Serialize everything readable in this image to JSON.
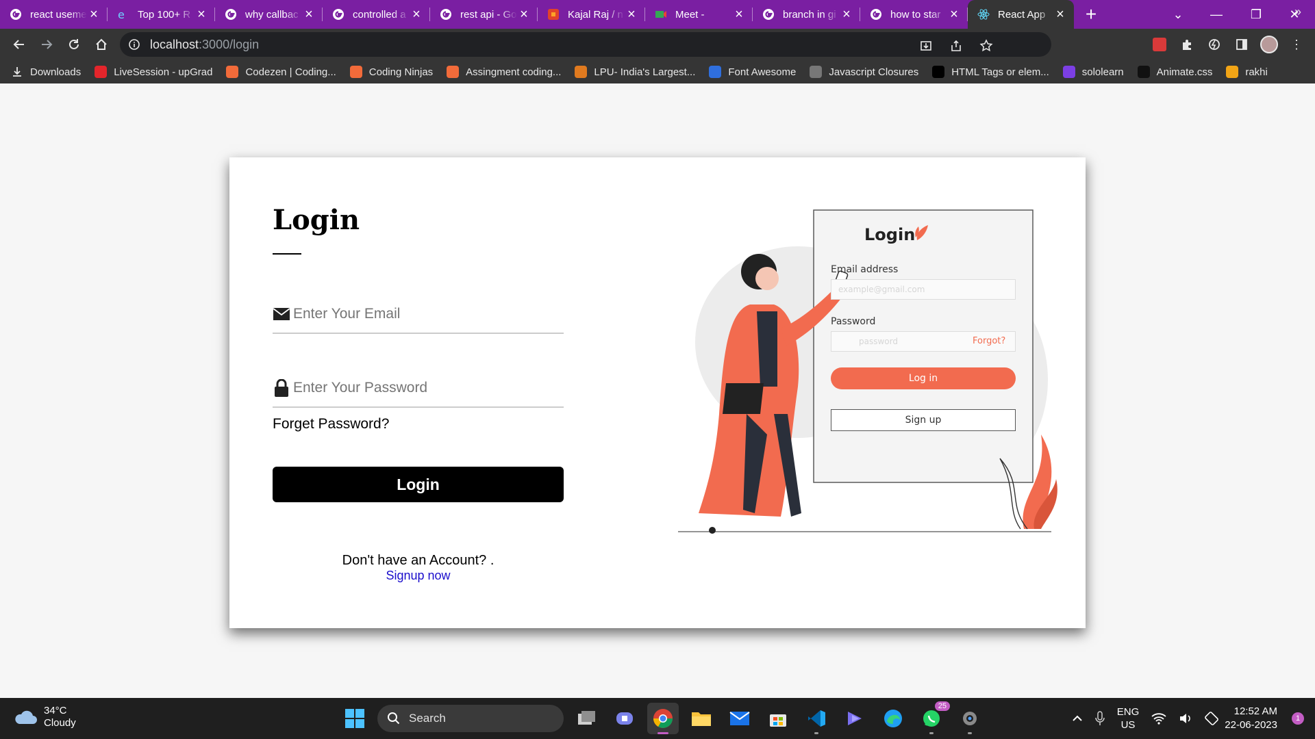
{
  "browser": {
    "tabs": [
      {
        "title": "react useme",
        "icon": "google-icon",
        "active": false
      },
      {
        "title": "Top 100+ R",
        "icon": "edureka-icon",
        "active": false
      },
      {
        "title": "why callbac",
        "icon": "google-icon",
        "active": false
      },
      {
        "title": "controlled a",
        "icon": "google-icon",
        "active": false
      },
      {
        "title": "rest api - Go",
        "icon": "google-icon",
        "active": false
      },
      {
        "title": "Kajal Raj / n",
        "icon": "gitlab-icon",
        "active": false
      },
      {
        "title": "Meet -",
        "icon": "meet-icon",
        "active": false
      },
      {
        "title": "branch in gi",
        "icon": "google-icon",
        "active": false
      },
      {
        "title": "how to star",
        "icon": "google-icon",
        "active": false
      },
      {
        "title": "React App",
        "icon": "react-icon",
        "active": true
      }
    ],
    "new_tab_label": "+",
    "url": {
      "host": "localhost",
      "path": ":3000/login"
    },
    "bookmarks": [
      {
        "label": "Downloads",
        "icon": "download-icon",
        "color": "#353535"
      },
      {
        "label": "LiveSession - upGrad",
        "icon": "upgrad-icon",
        "color": "#e4252b"
      },
      {
        "label": "Codezen | Coding...",
        "icon": "codezen-icon",
        "color": "#f26b3a"
      },
      {
        "label": "Coding Ninjas",
        "icon": "codingninjas-icon",
        "color": "#f26b3a"
      },
      {
        "label": "Assingment coding...",
        "icon": "codingninjas-icon",
        "color": "#f26b3a"
      },
      {
        "label": "LPU- India's Largest...",
        "icon": "lpu-icon",
        "color": "#e07a1f"
      },
      {
        "label": "Font Awesome",
        "icon": "flag-icon",
        "color": "#2f6fde"
      },
      {
        "label": "Javascript Closures",
        "icon": "globe-icon",
        "color": "#777777"
      },
      {
        "label": "HTML Tags or elem...",
        "icon": "medium-icon",
        "color": "#000000"
      },
      {
        "label": "sololearn",
        "icon": "sololearn-icon",
        "color": "#7c3fe4"
      },
      {
        "label": "Animate.css",
        "icon": "animate-icon",
        "color": "#111111"
      },
      {
        "label": "rakhi",
        "icon": "rakhi-icon",
        "color": "#f2a516"
      }
    ],
    "bookmarks_more": "»"
  },
  "login_page": {
    "title": "Login",
    "email_placeholder": "Enter Your Email",
    "password_placeholder": "Enter Your Password",
    "forgot_label": "Forget Password?",
    "login_button": "Login",
    "no_account_text": "Don't have an Account? .",
    "signup_link": "Signup now",
    "illustration": {
      "title": "Login",
      "email_label": "Email address",
      "email_placeholder": "example@gmail.com",
      "password_label": "Password",
      "password_placeholder": "password",
      "forgot_label": "Forgot?",
      "login_button": "Log in",
      "signup_button": "Sign up",
      "accent_color": "#f26b4f"
    }
  },
  "taskbar": {
    "weather_temp": "34°C",
    "weather_desc": "Cloudy",
    "search_label": "Search",
    "whatsapp_badge": "25",
    "lang_line1": "ENG",
    "lang_line2": "US",
    "time": "12:52 AM",
    "date": "22-06-2023",
    "notification_count": "1"
  }
}
